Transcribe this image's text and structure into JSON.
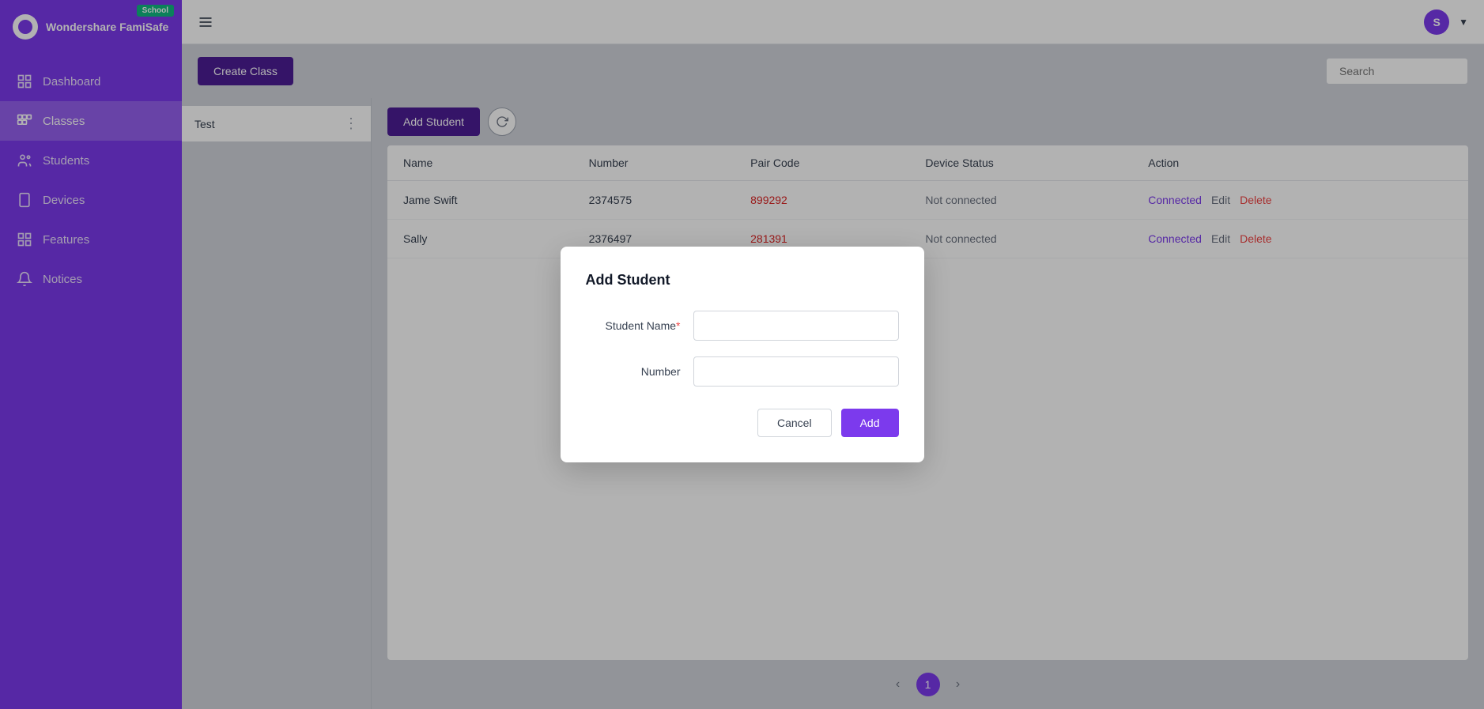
{
  "app": {
    "name": "Wondershare FamiSafe",
    "badge": "School"
  },
  "sidebar": {
    "items": [
      {
        "id": "dashboard",
        "label": "Dashboard",
        "active": false
      },
      {
        "id": "classes",
        "label": "Classes",
        "active": true
      },
      {
        "id": "students",
        "label": "Students",
        "active": false
      },
      {
        "id": "devices",
        "label": "Devices",
        "active": false
      },
      {
        "id": "features",
        "label": "Features",
        "active": false
      },
      {
        "id": "notices",
        "label": "Notices",
        "active": false
      }
    ]
  },
  "topbar": {
    "user_initial": "S",
    "search_placeholder": "Search"
  },
  "toolbar": {
    "create_class_label": "Create Class",
    "add_student_label": "Add Student"
  },
  "class_panel": {
    "current_class": "Test"
  },
  "table": {
    "columns": [
      "Name",
      "Number",
      "Pair Code",
      "Device Status",
      "Action"
    ],
    "rows": [
      {
        "name": "Jame Swift",
        "number": "2374575",
        "pair_code": "899292",
        "device_status": "Not connected",
        "actions": [
          "Connected",
          "Edit",
          "Delete"
        ]
      },
      {
        "name": "Sally",
        "number": "2376497",
        "pair_code": "281391",
        "device_status": "Not connected",
        "actions": [
          "Connected",
          "Edit",
          "Delete"
        ]
      }
    ]
  },
  "pagination": {
    "current_page": "1"
  },
  "modal": {
    "title": "Add Student",
    "student_name_label": "Student Name",
    "number_label": "Number",
    "student_name_placeholder": "",
    "number_placeholder": "",
    "cancel_label": "Cancel",
    "add_label": "Add"
  }
}
